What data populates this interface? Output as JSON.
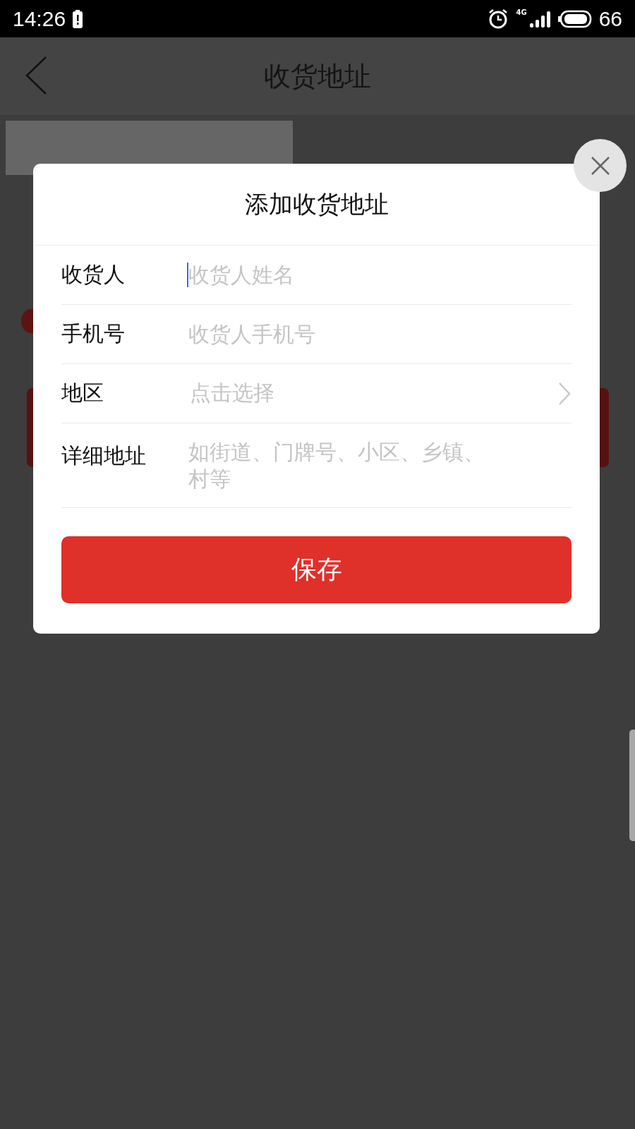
{
  "status_bar": {
    "time": "14:26",
    "network": "4G",
    "battery": "66"
  },
  "header": {
    "title": "收货地址"
  },
  "dialog": {
    "title": "添加收货地址",
    "fields": [
      {
        "kind": "text",
        "label": "收货人",
        "placeholder": "收货人姓名",
        "focused": true
      },
      {
        "kind": "text",
        "label": "手机号",
        "placeholder": "收货人手机号",
        "focused": false
      },
      {
        "kind": "select",
        "label": "地区",
        "placeholder": "点击选择",
        "focused": false
      },
      {
        "kind": "textarea",
        "label": "详细地址",
        "placeholder": "如街道、门牌号、小区、乡镇、村等",
        "focused": false
      }
    ],
    "save_button": "保存"
  }
}
